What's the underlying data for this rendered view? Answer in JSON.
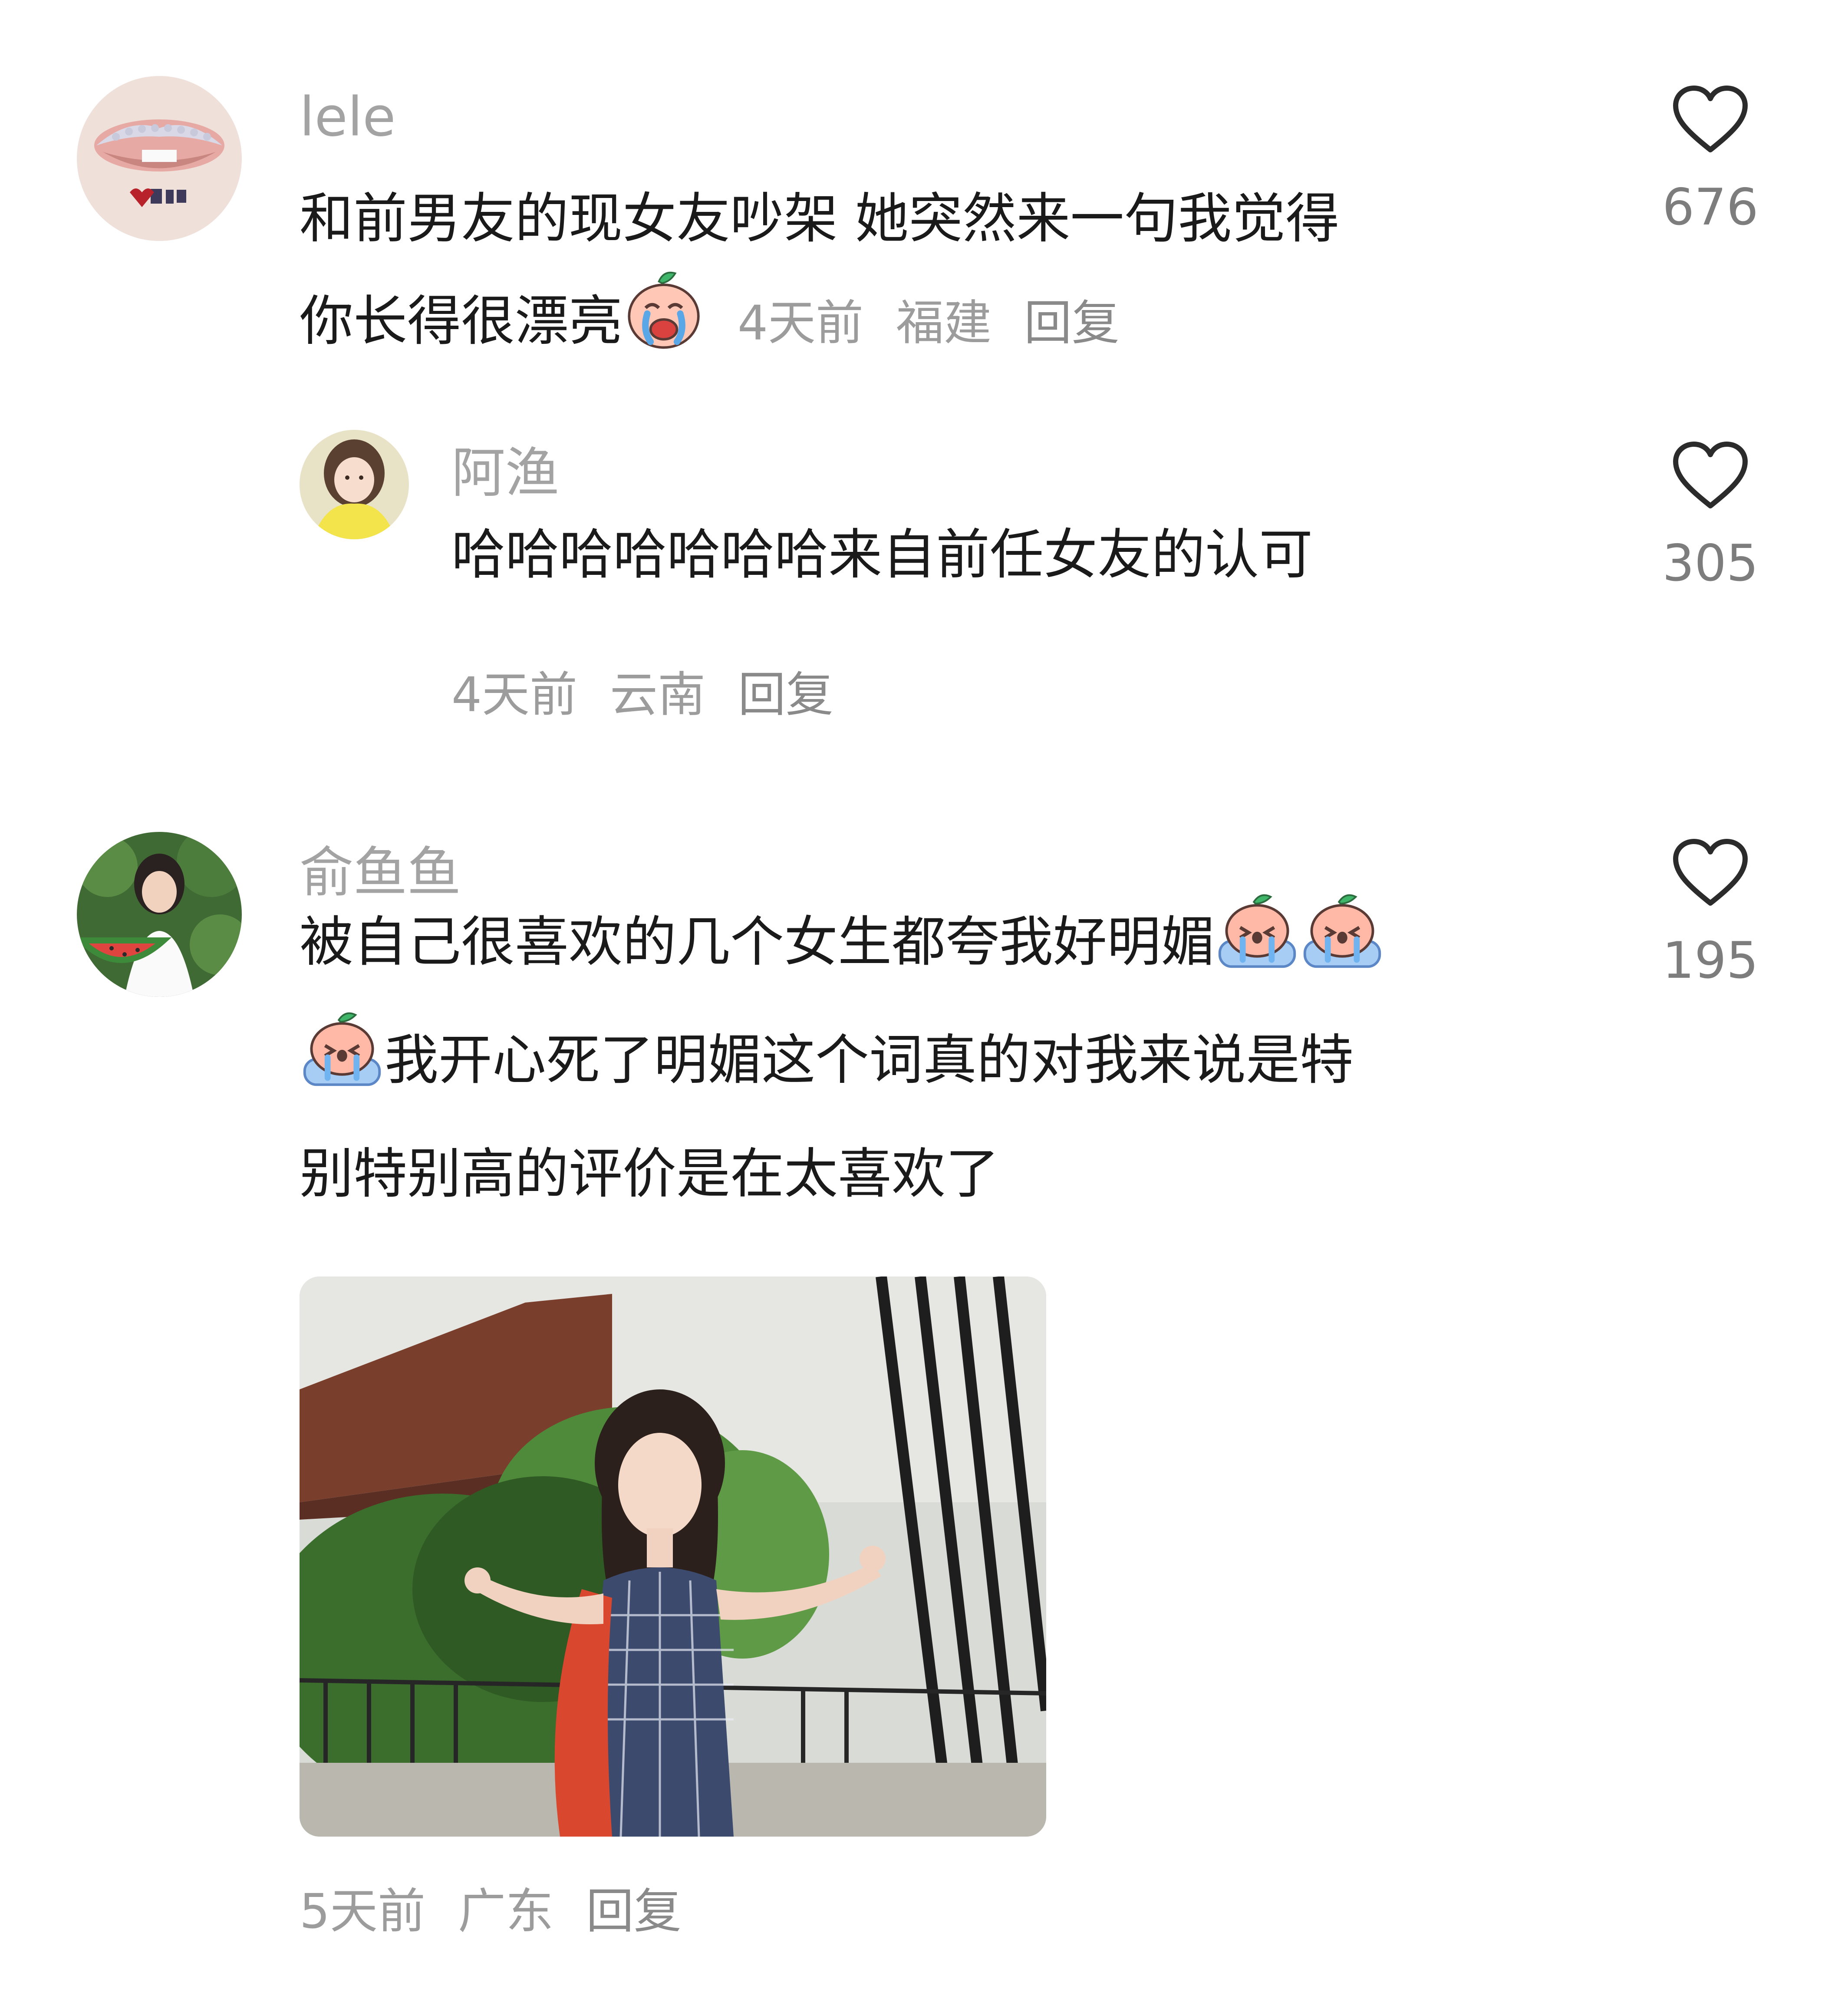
{
  "comments": [
    {
      "username": "lele",
      "text_line1": "和前男友的现女友吵架 她突然来一句我觉得",
      "text_line2": "你长得很漂亮",
      "emoji": "crying-face-emoji",
      "time": "4天前",
      "location": "福建",
      "reply_label": "回复",
      "likes": "676"
    },
    {
      "username": "阿渔",
      "text": "哈哈哈哈哈哈哈来自前任女友的认可",
      "time": "4天前",
      "location": "云南",
      "reply_label": "回复",
      "likes": "305"
    },
    {
      "username": "俞鱼鱼",
      "text_line1": "被自己很喜欢的几个女生都夸我好明媚",
      "text_line2": "我开心死了明媚这个词真的对我来说是特",
      "text_line3": "别特别高的评价是在太喜欢了",
      "emoji": "sobbing-peach-emoji",
      "time": "5天前",
      "location": "广东",
      "reply_label": "回复",
      "likes": "195"
    }
  ],
  "icons": {
    "like": "heart-outline-icon"
  },
  "colors": {
    "username": "#a3a3a3",
    "text": "#1a1a1a",
    "meta": "#9c9c9c",
    "count": "#7d7d7d"
  }
}
